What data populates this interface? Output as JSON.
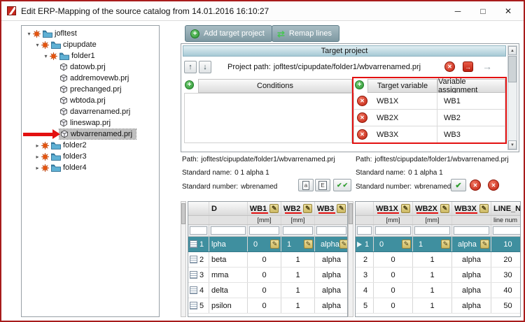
{
  "window": {
    "title": "Edit ERP-Mapping of the source catalog from 14.01.2016 16:10:27",
    "controls": {
      "minimize": "─",
      "maximize": "□",
      "close": "✕"
    }
  },
  "icons": {
    "close": "✕",
    "check": "✔",
    "plus": "+",
    "pencil": "✎",
    "up_arrow": "↑",
    "down_arrow": "↓",
    "right_arrow": "→",
    "swap": "⇄",
    "scroll_up": "▲",
    "scroll_down": "▼",
    "chevron_expanded": "▾",
    "chevron_collapsed": "▸",
    "letter_a": "a",
    "letter_e": "E"
  },
  "toolbar": {
    "add_target_project": "Add target project",
    "remap_lines": "Remap lines"
  },
  "tree": {
    "items": [
      {
        "label": "jofltest"
      },
      {
        "label": "cipupdate"
      },
      {
        "label": "folder1"
      },
      {
        "label": "datowb.prj"
      },
      {
        "label": "addremovewb.prj"
      },
      {
        "label": "prechanged.prj"
      },
      {
        "label": "wbtoda.prj"
      },
      {
        "label": "davarrenamed.prj"
      },
      {
        "label": "lineswap.prj"
      },
      {
        "label": "wbvarrenamed.prj"
      },
      {
        "label": "folder2"
      },
      {
        "label": "folder3"
      },
      {
        "label": "folder4"
      }
    ]
  },
  "target_panel": {
    "title": "Target project",
    "project_path_label": "Project path:",
    "project_path": "jofltest/cipupdate/folder1/wbvarrenamed.prj",
    "conditions_header": "Conditions",
    "target_variable_header": "Target variable",
    "variable_assignment_header": "Variable assignment",
    "mappings": [
      {
        "target": "WB1X",
        "assignment": "WB1"
      },
      {
        "target": "WB2X",
        "assignment": "WB2"
      },
      {
        "target": "WB3X",
        "assignment": "WB3"
      }
    ]
  },
  "source_info": {
    "path_label": "Path:",
    "path": "jofltest/cipupdate/folder1/wbvarrenamed.prj",
    "standard_name_label": "Standard name:",
    "standard_name": "0 1 alpha 1",
    "standard_number_label": "Standard number:",
    "standard_number": "wbrenamed"
  },
  "target_info": {
    "path_label": "Path:",
    "path": "jofltest/cipupdate/folder1/wbvarrenamed.prj",
    "standard_name_label": "Standard name:",
    "standard_name": "0 1 alpha 1",
    "standard_number_label": "Standard number:",
    "standard_number": "wbrenamed"
  },
  "left_table": {
    "name_header": "D",
    "col_headers": [
      "WB1",
      "WB2",
      "WB3"
    ],
    "units": [
      "[mm]",
      "[mm]",
      ""
    ],
    "rows": [
      {
        "num": "1",
        "name": "lpha",
        "values": [
          "0",
          "1",
          "alpha"
        ],
        "selected": true
      },
      {
        "num": "2",
        "name": "beta",
        "values": [
          "0",
          "1",
          "alpha"
        ]
      },
      {
        "num": "3",
        "name": "mma",
        "values": [
          "0",
          "1",
          "alpha"
        ]
      },
      {
        "num": "4",
        "name": "delta",
        "values": [
          "0",
          "1",
          "alpha"
        ]
      },
      {
        "num": "5",
        "name": "psilon",
        "values": [
          "0",
          "1",
          "alpha"
        ]
      }
    ]
  },
  "right_table": {
    "col_headers": [
      "WB1X",
      "WB2X",
      "WB3X",
      "LINE_N"
    ],
    "units": [
      "[mm]",
      "[mm]",
      "",
      "line num"
    ],
    "rows": [
      {
        "num": "1",
        "values": [
          "0",
          "1",
          "alpha",
          "10"
        ],
        "selected": true
      },
      {
        "num": "2",
        "values": [
          "0",
          "1",
          "alpha",
          "20"
        ]
      },
      {
        "num": "3",
        "values": [
          "0",
          "1",
          "alpha",
          "30"
        ]
      },
      {
        "num": "4",
        "values": [
          "0",
          "1",
          "alpha",
          "40"
        ]
      },
      {
        "num": "5",
        "values": [
          "0",
          "1",
          "alpha",
          "50"
        ]
      }
    ]
  },
  "colors": {
    "selection_teal": "#3f8f9f",
    "annotation_red": "#e31010",
    "button_teal": "#7e99a2",
    "plus_green": "#2e9634",
    "delete_red": "#c22110"
  }
}
